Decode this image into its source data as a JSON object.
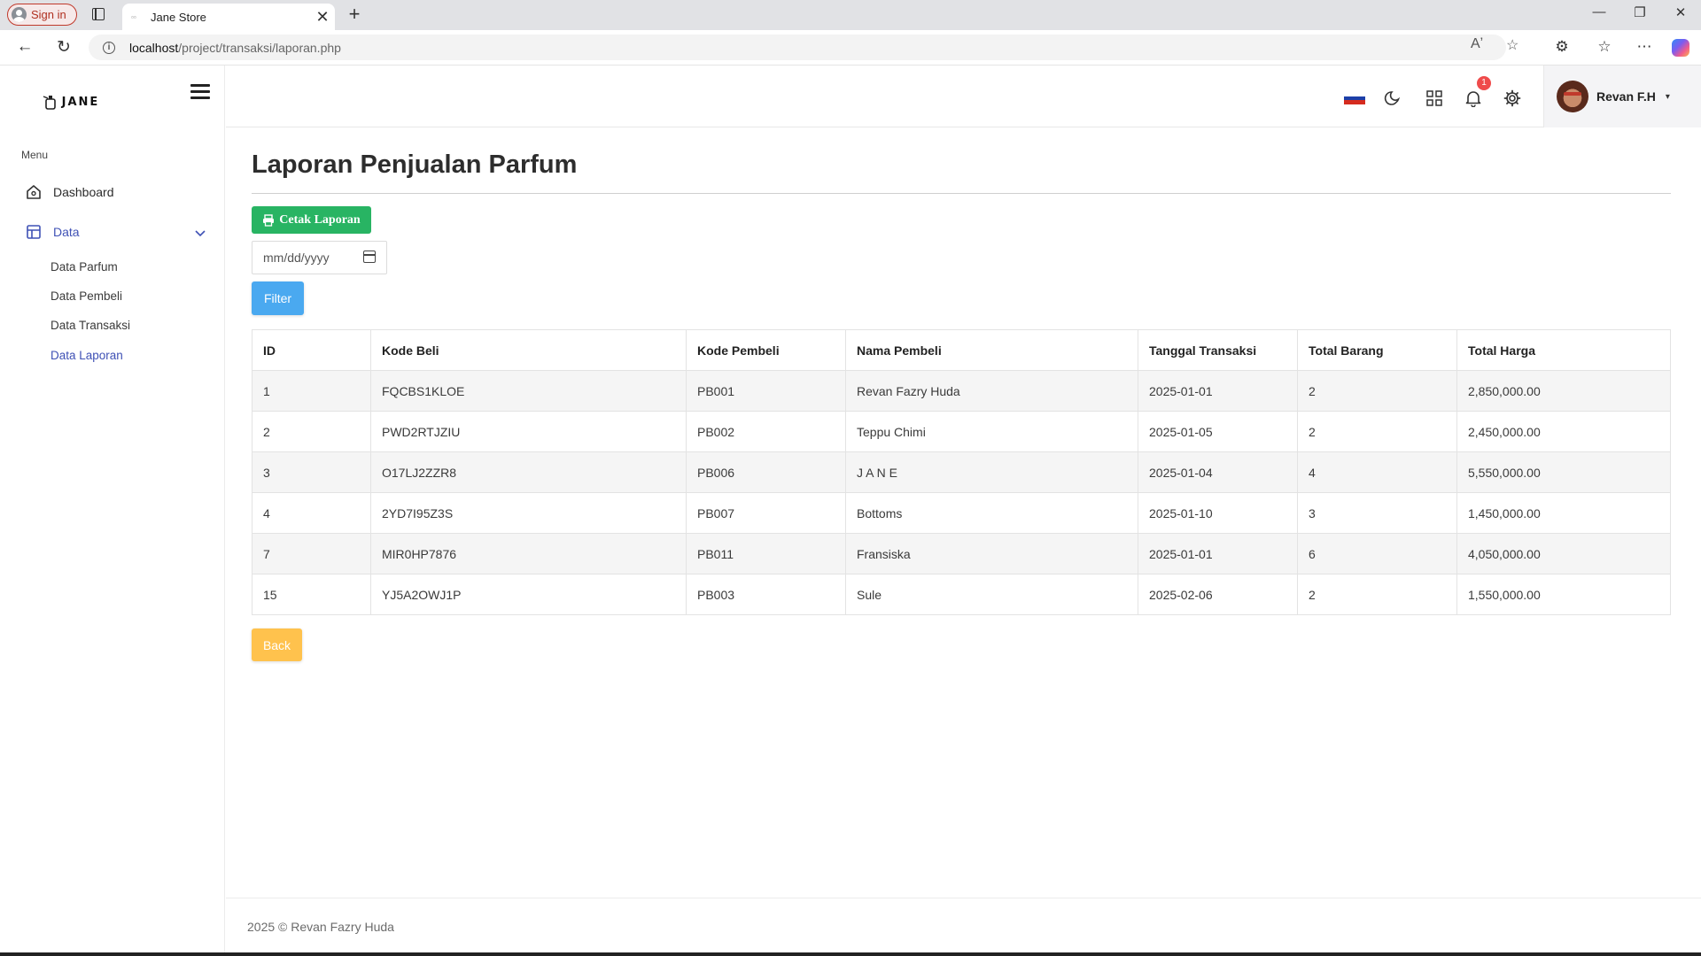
{
  "browser": {
    "sign_in_label": "Sign in",
    "tab_title": "Jane Store",
    "url_host": "localhost",
    "url_path": "/project/transaksi/laporan.php"
  },
  "sidebar": {
    "logo_text": "JANE",
    "menu_label": "Menu",
    "items": [
      {
        "label": "Dashboard",
        "icon": "home-icon"
      },
      {
        "label": "Data",
        "icon": "layout-icon"
      }
    ],
    "sub_items": [
      {
        "label": "Data Parfum"
      },
      {
        "label": "Data Pembeli"
      },
      {
        "label": "Data Transaksi"
      },
      {
        "label": "Data Laporan"
      }
    ],
    "active_sub": "Data Laporan"
  },
  "topnav": {
    "notification_count": "1",
    "user_name": "Revan F.H",
    "flag_colors": [
      "#ffffff",
      "#1c3fa8",
      "#d52b1e"
    ]
  },
  "main": {
    "title": "Laporan Penjualan Parfum",
    "print_button": "Cetak Laporan",
    "date_placeholder": "mm/dd/yyyy",
    "filter_button": "Filter",
    "back_button": "Back",
    "table": {
      "headers": [
        "ID",
        "Kode Beli",
        "Kode Pembeli",
        "Nama Pembeli",
        "Tanggal Transaksi",
        "Total Barang",
        "Total Harga"
      ],
      "rows": [
        [
          "1",
          "FQCBS1KLOE",
          "PB001",
          "Revan Fazry Huda",
          "2025-01-01",
          "2",
          "2,850,000.00"
        ],
        [
          "2",
          "PWD2RTJZIU",
          "PB002",
          "Teppu Chimi",
          "2025-01-05",
          "2",
          "2,450,000.00"
        ],
        [
          "3",
          "O17LJ2ZZR8",
          "PB006",
          "J A N E",
          "2025-01-04",
          "4",
          "5,550,000.00"
        ],
        [
          "4",
          "2YD7I95Z3S",
          "PB007",
          "Bottoms",
          "2025-01-10",
          "3",
          "1,450,000.00"
        ],
        [
          "7",
          "MIR0HP7876",
          "PB011",
          "Fransiska",
          "2025-01-01",
          "6",
          "4,050,000.00"
        ],
        [
          "15",
          "YJ5A2OWJ1P",
          "PB003",
          "Sule",
          "2025-02-06",
          "2",
          "1,550,000.00"
        ]
      ]
    }
  },
  "footer": {
    "text": "2025 © Revan Fazry Huda"
  },
  "colors": {
    "accent": "#3f51b5",
    "print_button": "#28b463",
    "filter_button": "#4aa9f0",
    "back_button": "#ffc24d",
    "badge": "#ef4b4b"
  }
}
